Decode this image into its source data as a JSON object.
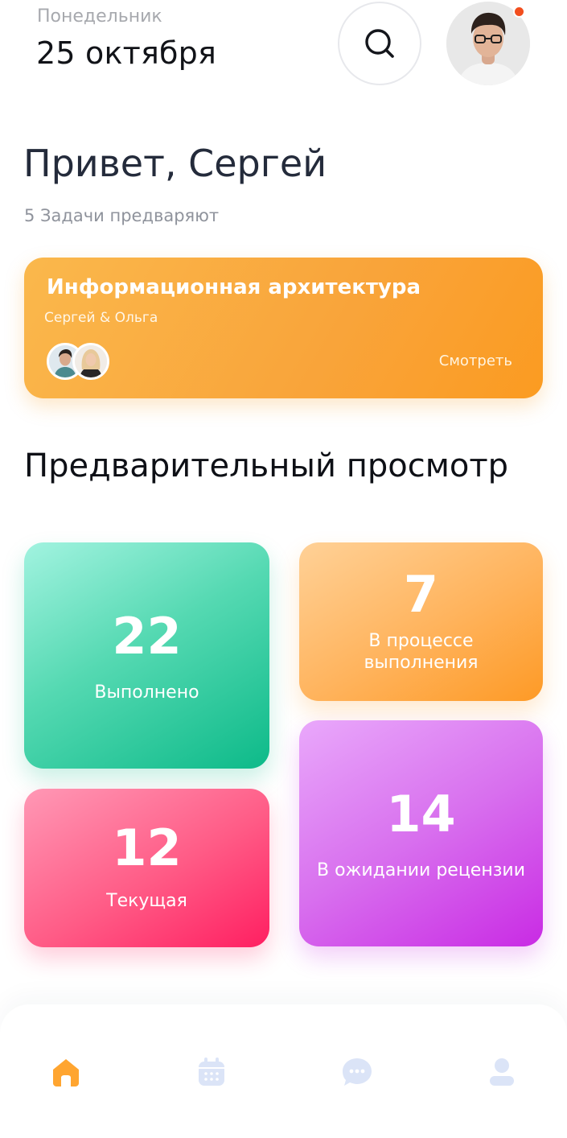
{
  "header": {
    "weekday": "Понедельник",
    "date": "25 октября",
    "notification_color": "#f24e1e"
  },
  "greeting": {
    "title": "Привет, Сергей",
    "subtitle": "5 Задачи предваряют"
  },
  "project_card": {
    "title": "Информационная архитектура",
    "members": "Сергей & Ольга",
    "view_label": "Смотреть",
    "accent": "#f9a43a"
  },
  "preview": {
    "title": "Предварительный просмотр",
    "stats": {
      "done": {
        "value": "22",
        "label": "Выполнено",
        "color": "#0dba89"
      },
      "in_progress": {
        "value": "7",
        "label": "В процессе выполнения",
        "color": "#fe9a26"
      },
      "current": {
        "value": "12",
        "label": "Текущая",
        "color": "#ff1f61"
      },
      "review": {
        "value": "14",
        "label": "В ожидании рецензии",
        "color": "#c92be4"
      }
    }
  },
  "nav": {
    "items": [
      {
        "icon": "home-icon",
        "active": true,
        "color": "#ffa530"
      },
      {
        "icon": "calendar-icon",
        "active": false,
        "color": "#dbe4f7"
      },
      {
        "icon": "chat-icon",
        "active": false,
        "color": "#dbe4f7"
      },
      {
        "icon": "profile-icon",
        "active": false,
        "color": "#dbe4f7"
      }
    ]
  }
}
